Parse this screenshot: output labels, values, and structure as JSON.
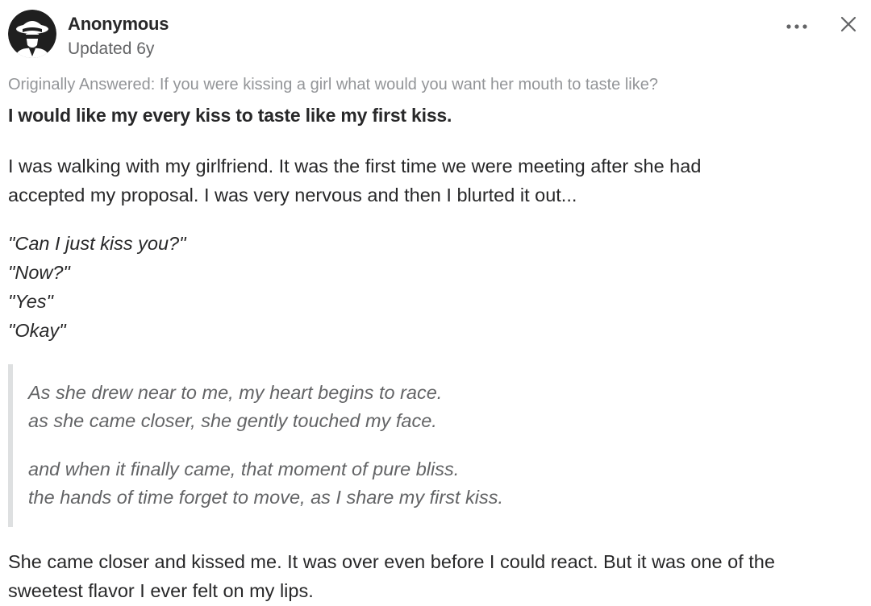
{
  "author": {
    "name": "Anonymous",
    "updated": "Updated 6y",
    "avatar_icon": "anonymous-avatar-icon"
  },
  "controls": {
    "more_icon": "more-horizontal-icon",
    "close_icon": "close-icon"
  },
  "question": {
    "originally_answered": "Originally Answered: If you were kissing a girl what would you want her mouth to taste like?"
  },
  "answer": {
    "headline": "I would like my every kiss to taste like my first kiss.",
    "paragraph1_line1": "I was walking with my girlfriend. It was the first time we were meeting after she had",
    "paragraph1_line2": "accepted my proposal. I was very nervous and then I blurted it out...",
    "dialog": [
      "\"Can I just kiss you?\"",
      "\"Now?\"",
      "\"Yes\"",
      "\"Okay\""
    ],
    "quote": {
      "line1": "As she drew near to me, my heart begins to race.",
      "line2": "as she came closer, she gently touched my face.",
      "line3": "and when it finally came, that moment of pure bliss.",
      "line4": "the hands of time forget to move, as I share my first kiss."
    },
    "paragraph2_line1": "She came closer and kissed me. It was over even before I could react. But it was one of the",
    "paragraph2_line2": "sweetest flavor I ever felt on my lips."
  },
  "colors": {
    "text": "#282829",
    "muted": "#636466",
    "light_muted": "#939598",
    "quote_bar": "#dee0e1"
  }
}
